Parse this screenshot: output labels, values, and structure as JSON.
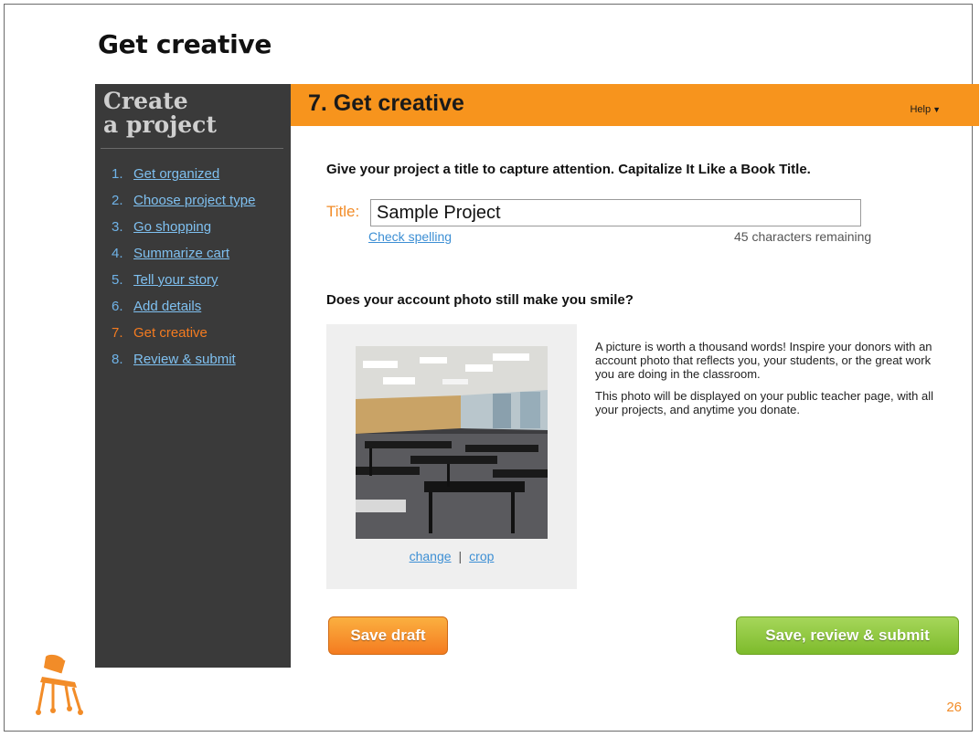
{
  "slide": {
    "title": "Get creative",
    "page_number": "26"
  },
  "sidebar": {
    "heading_line1": "Create",
    "heading_line2": "a project",
    "items": [
      {
        "num": "1.",
        "label": "Get organized",
        "active": false
      },
      {
        "num": "2.",
        "label": "Choose project type",
        "active": false
      },
      {
        "num": "3.",
        "label": "Go shopping",
        "active": false
      },
      {
        "num": "4.",
        "label": "Summarize cart",
        "active": false
      },
      {
        "num": "5.",
        "label": "Tell your story",
        "active": false
      },
      {
        "num": "6.",
        "label": "Add details",
        "active": false
      },
      {
        "num": "7.",
        "label": "Get creative",
        "active": true
      },
      {
        "num": "8.",
        "label": "Review & submit",
        "active": false
      }
    ]
  },
  "header": {
    "title": "7. Get creative",
    "help_label": "Help"
  },
  "form": {
    "title_prompt": "Give your project a title to capture attention. Capitalize It Like a Book Title.",
    "title_label": "Title:",
    "title_value": "Sample Project",
    "check_spelling": "Check spelling",
    "chars_remaining": "45 characters remaining"
  },
  "photo": {
    "prompt": "Does your account photo still make you smile?",
    "change_label": "change",
    "separator": "|",
    "crop_label": "crop",
    "description_1": "A picture is worth a thousand words! Inspire your donors with an account photo that reflects you, your students, or the great work you are doing in the classroom.",
    "description_2": "This photo will be displayed on your public teacher page, with all your projects, and anytime you donate."
  },
  "buttons": {
    "save_draft": "Save draft",
    "save_submit": "Save, review & submit"
  },
  "colors": {
    "accent_orange": "#f7941d",
    "sidebar_bg": "#3a3a3a",
    "link_blue": "#3d8fd4",
    "submit_green": "#7dbb2c"
  }
}
